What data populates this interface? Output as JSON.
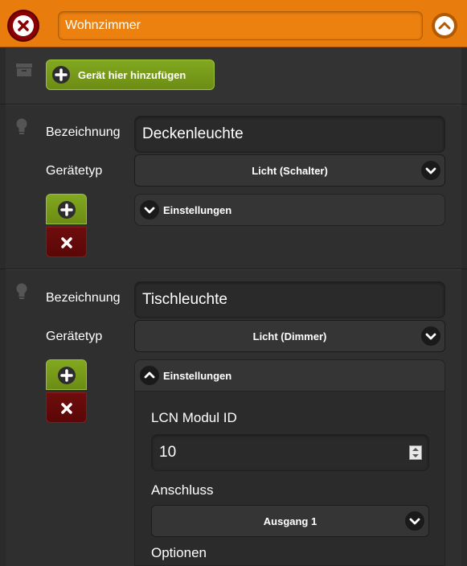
{
  "header": {
    "room_name": "Wohnzimmer"
  },
  "add_section": {
    "add_button_label": "Gerät hier hinzufügen"
  },
  "devices": [
    {
      "name_label": "Bezeichnung",
      "name_value": "Deckenleuchte",
      "type_label": "Gerätetyp",
      "type_value": "Licht (Schalter)",
      "settings_label": "Einstellungen",
      "settings_expanded": false
    },
    {
      "name_label": "Bezeichnung",
      "name_value": "Tischleuchte",
      "type_label": "Gerätetyp",
      "type_value": "Licht (Dimmer)",
      "settings_label": "Einstellungen",
      "settings_expanded": true,
      "settings": {
        "module_id_label": "LCN Modul ID",
        "module_id_value": "10",
        "output_label": "Anschluss",
        "output_value": "Ausgang 1",
        "options_label": "Optionen"
      }
    }
  ],
  "colors": {
    "header": "#e87c0c",
    "green": "#7a9e1a",
    "red": "#650a0a",
    "background": "#2b2b2b"
  }
}
